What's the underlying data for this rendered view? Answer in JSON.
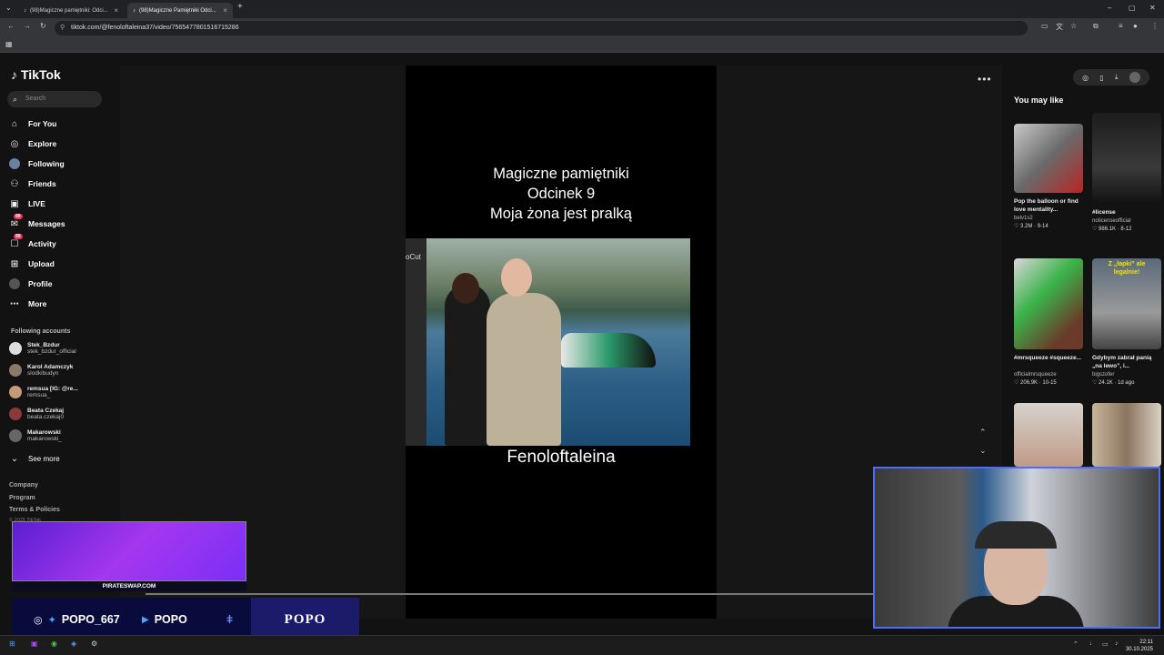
{
  "browser": {
    "tabs": [
      {
        "label": "(98)Magiczne pamiętniki: Odci...",
        "active": false
      },
      {
        "label": "(98)Magiczne Pamiętniki Odci...",
        "active": true
      }
    ],
    "url": "tiktok.com/@fenoloftaleina37/video/7565477801516715286",
    "new_tab": "+"
  },
  "sidebar": {
    "logo": "TikTok",
    "search_placeholder": "Search",
    "nav": [
      {
        "label": "For You",
        "icon": "home-icon"
      },
      {
        "label": "Explore",
        "icon": "compass-icon"
      },
      {
        "label": "Following",
        "icon": "following-avatar-icon"
      },
      {
        "label": "Friends",
        "icon": "friends-icon"
      },
      {
        "label": "LIVE",
        "icon": "live-icon"
      },
      {
        "label": "Messages",
        "icon": "messages-icon",
        "badge": "99"
      },
      {
        "label": "Activity",
        "icon": "activity-icon",
        "badge": "99"
      },
      {
        "label": "Upload",
        "icon": "upload-icon"
      },
      {
        "label": "Profile",
        "icon": "profile-avatar-icon"
      },
      {
        "label": "More",
        "icon": "more-icon"
      }
    ],
    "following_title": "Following accounts",
    "following": [
      {
        "name": "Stek_Bzdur",
        "handle": "stek_bzdur_official"
      },
      {
        "name": "Karol Adamczyk",
        "handle": "slodkibudyn"
      },
      {
        "name": "remsua [IG: @re...",
        "handle": "remsua_"
      },
      {
        "name": "Beata Czekaj",
        "handle": "beata.czekaj0"
      },
      {
        "name": "Makarowski",
        "handle": "makarowski_"
      }
    ],
    "see_more": "See more",
    "footer": [
      "Company",
      "Program",
      "Terms & Policies"
    ],
    "copyright": "© 2025 TikTok"
  },
  "video": {
    "title_lines": [
      "Magiczne pamiętniki",
      "Odcinek 9",
      "Moja żona jest pralką"
    ],
    "side_watermark": "oCut",
    "caption": "Fenoloftaleina"
  },
  "right": {
    "heading": "You may like",
    "recommendations": [
      {
        "title": "Pop the balloon or find love mentality...",
        "author": "belv1s2",
        "meta": "♡ 3.2M · 9-14",
        "color": "#8a8a8a"
      },
      {
        "title": "#license",
        "author": "noticenseofficial",
        "meta": "♡ 986.1K · 8-12",
        "color": "#2b2b2b"
      },
      {
        "title": "#mrsqueeze #squeeze...",
        "author": "officialmrsqueeze",
        "meta": "♡ 206.9K · 10-15",
        "color": "#5a6b5a"
      },
      {
        "title": "Gdybym zabrał panią „na lewo”, i...",
        "author": "bigszofer",
        "meta": "♡ 24.1K · 1d ago",
        "color": "#6e6e6e",
        "overlay": "Z „łapki” ale legalnie!"
      },
      {
        "title": "",
        "author": "",
        "meta": "",
        "color": "#cfc6be"
      },
      {
        "title": "",
        "author": "",
        "meta": "",
        "color": "#b8a58e"
      }
    ]
  },
  "overlay": {
    "promo_site": "PIRATESWAP.COM",
    "social_handle": "POPO_667",
    "youtube_name": "POPO",
    "brand_box": "POPO"
  },
  "taskbar": {
    "time": "22:11",
    "date": "30.10.2025"
  }
}
